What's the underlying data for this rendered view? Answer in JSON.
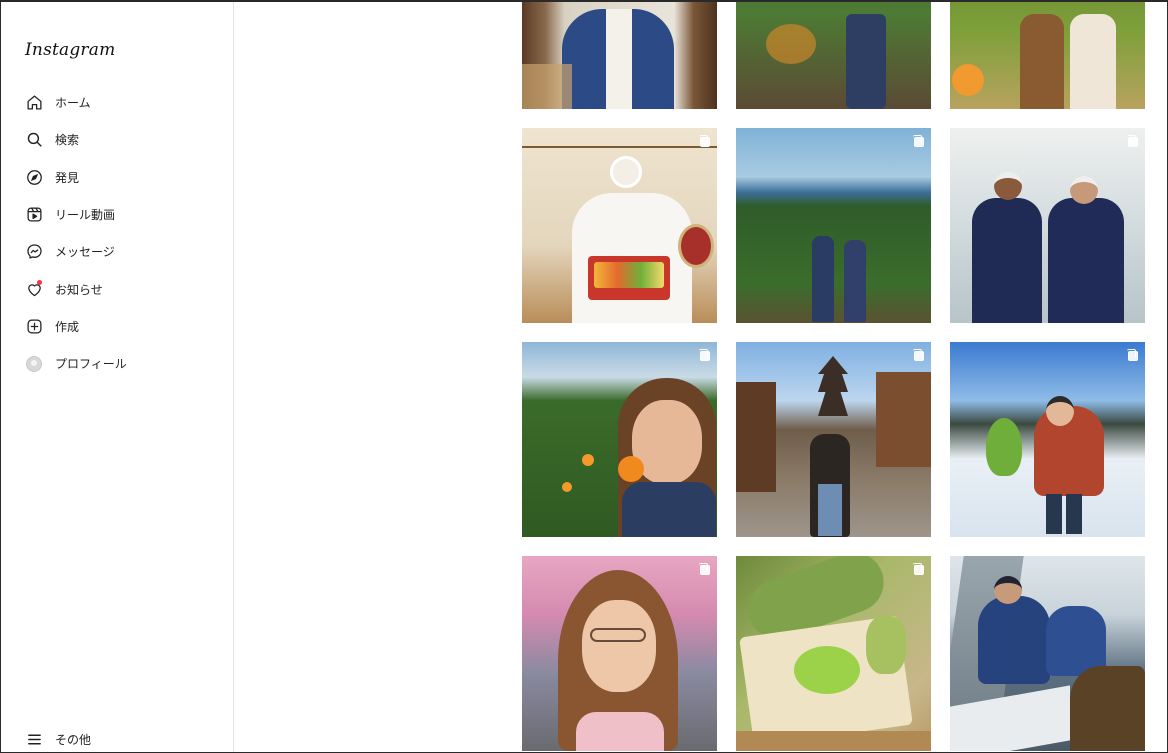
{
  "app": {
    "logo": "Instagram"
  },
  "sidebar": {
    "items": [
      {
        "label": "ホーム",
        "icon": "home-icon"
      },
      {
        "label": "検索",
        "icon": "search-icon"
      },
      {
        "label": "発見",
        "icon": "compass-icon"
      },
      {
        "label": "リール動画",
        "icon": "reels-icon"
      },
      {
        "label": "メッセージ",
        "icon": "messenger-icon"
      },
      {
        "label": "お知らせ",
        "icon": "heart-icon"
      },
      {
        "label": "作成",
        "icon": "create-plus-icon"
      },
      {
        "label": "プロフィール",
        "icon": "avatar"
      }
    ],
    "more": {
      "label": "その他",
      "icon": "menu-icon"
    }
  },
  "grid": {
    "posts": [
      {
        "subject": "man in blue happi coat",
        "multi": false
      },
      {
        "subject": "people in citrus orchard",
        "multi": false
      },
      {
        "subject": "two women with oranges",
        "multi": false
      },
      {
        "subject": "chef holding sushi box",
        "multi": true
      },
      {
        "subject": "couple in orchard by the sea",
        "multi": true
      },
      {
        "subject": "two men in happi coats",
        "multi": true
      },
      {
        "subject": "woman with mandarin orange",
        "multi": true
      },
      {
        "subject": "man on street with pagoda",
        "multi": true
      },
      {
        "subject": "woman holding daikon in snow",
        "multi": true
      },
      {
        "subject": "woman with glasses under cherry blossoms",
        "multi": true
      },
      {
        "subject": "wasabi root and grater",
        "multi": true
      },
      {
        "subject": "fishermen on boat",
        "multi": false
      }
    ]
  },
  "colors": {
    "accent_notification": "#ff3040",
    "border": "#e3e3e3"
  }
}
